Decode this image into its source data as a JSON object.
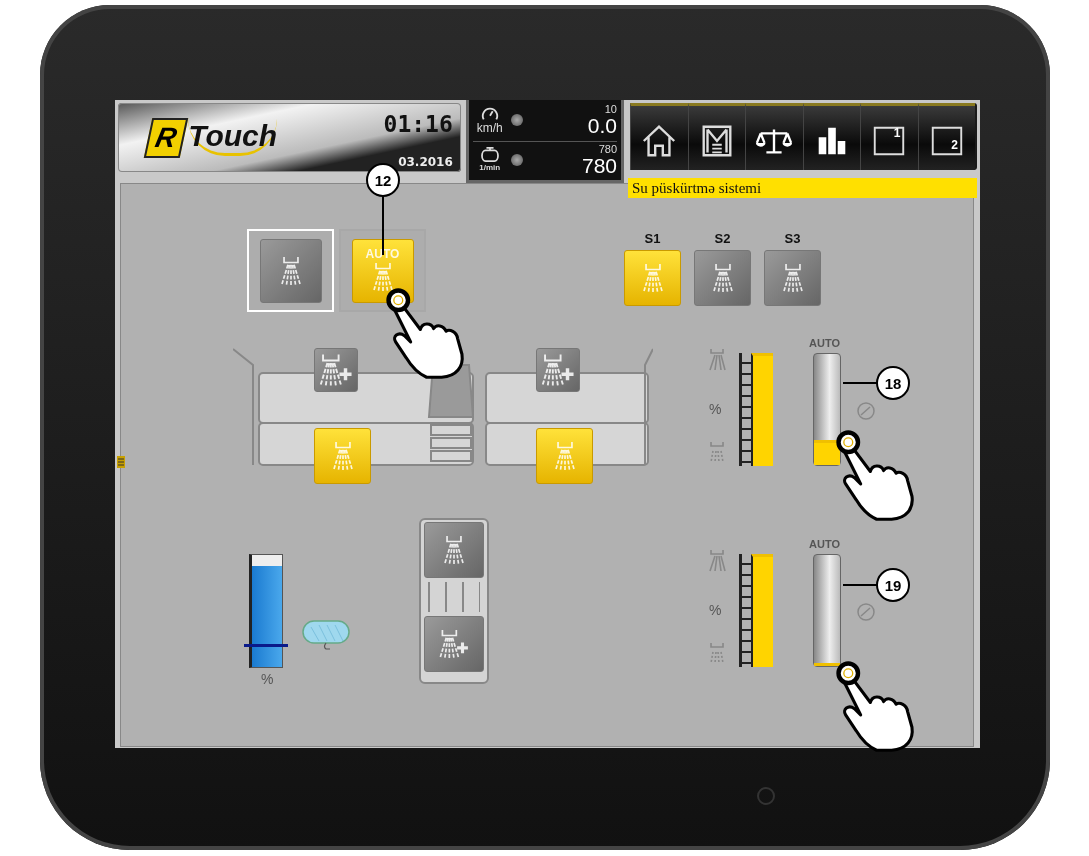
{
  "header": {
    "logo_letter": "R",
    "logo_word": "Touch",
    "time": "01:16",
    "date": "03.2016"
  },
  "readouts": [
    {
      "kind": "speed",
      "unit": "km/h",
      "target": "10",
      "value": "0.0"
    },
    {
      "kind": "engine",
      "unit": "1/min",
      "target": "780",
      "value": "780"
    }
  ],
  "nav_buttons": [
    {
      "kind": "home"
    },
    {
      "kind": "menu"
    },
    {
      "kind": "scale"
    },
    {
      "kind": "chart"
    },
    {
      "kind": "window",
      "label": "1"
    },
    {
      "kind": "window",
      "label": "2"
    }
  ],
  "status_message": "Su püskürtmə sistemi",
  "modes": [
    {
      "kind": "manual",
      "selected": true,
      "on": false
    },
    {
      "kind": "auto",
      "label": "AUTO",
      "selected": false,
      "on": true
    }
  ],
  "sections": [
    {
      "label": "S1",
      "on": true
    },
    {
      "label": "S2",
      "on": false
    },
    {
      "label": "S3",
      "on": false
    }
  ],
  "boom_sides": [
    {
      "booster_on": false,
      "main_on": true
    },
    {
      "booster_on": false,
      "main_on": true
    }
  ],
  "controls": [
    {
      "flow": {
        "label": "%",
        "level": 1
      },
      "pressure": {
        "label": "AUTO",
        "level": 0.2
      }
    },
    {
      "flow": {
        "label": "%",
        "level": 1
      },
      "pressure": {
        "label": "AUTO",
        "level": 0
      }
    }
  ],
  "tank": {
    "level": 0.9,
    "label": "%",
    "alarm": {
      "level": 0.18
    }
  },
  "rear_unit": {
    "main_on": false,
    "booster_on": false
  },
  "callouts": [
    {
      "number": "12"
    },
    {
      "number": "18"
    },
    {
      "number": "19"
    }
  ]
}
